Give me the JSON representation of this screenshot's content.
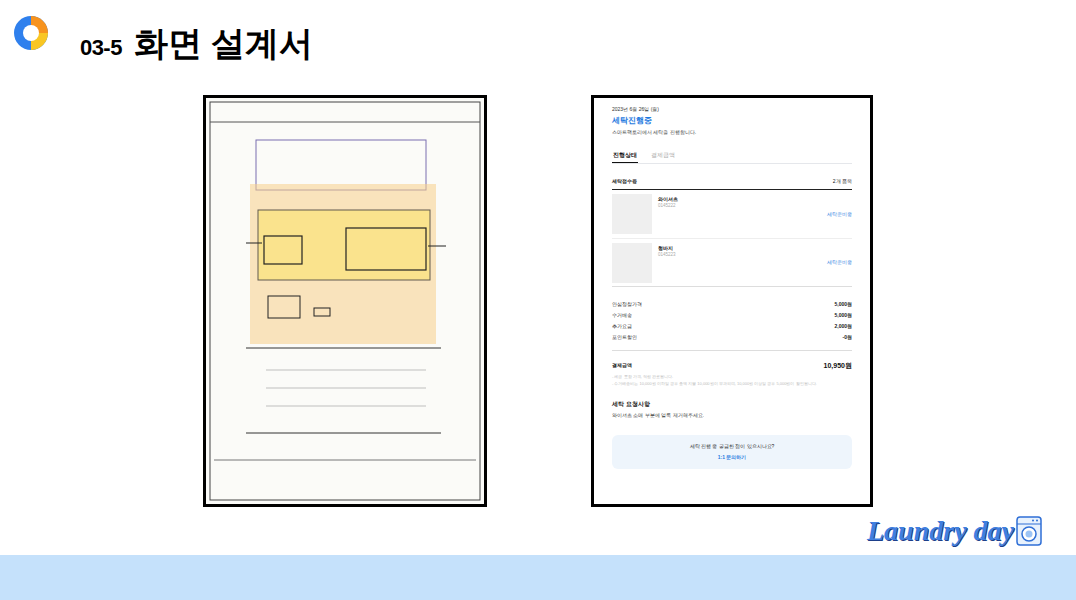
{
  "slide": {
    "section_number": "03-5",
    "title": "화면 설계서"
  },
  "mockup": {
    "date": "2023년 6월 26일 (월)",
    "status_title": "세탁진행중",
    "status_subtitle": "스마트팩토리에서 세탁을 진행합니다.",
    "tabs": [
      {
        "label": "진행상태",
        "selected": true
      },
      {
        "label": "결제금액",
        "selected": false
      }
    ],
    "receipt": {
      "label": "세탁접수증",
      "count": "2개 품목"
    },
    "items": [
      {
        "name": "와이셔츠",
        "code": "0145222",
        "status": "세탁준비중"
      },
      {
        "name": "청바지",
        "code": "0145223",
        "status": "세탁준비중"
      }
    ],
    "prices": [
      {
        "label": "안심정찰가격",
        "value": "5,000원"
      },
      {
        "label": "수거배송",
        "value": "5,000원"
      },
      {
        "label": "추가요금",
        "value": "2,000원"
      },
      {
        "label": "포인트할인",
        "value": "-0원"
      }
    ],
    "total": {
      "label": "결제금액",
      "value": "10,950원"
    },
    "notes": [
      "- 세금 포함 가격, 적립 완료됩니다.",
      "- 수거배송비는 10,000원 이하일 경우 총액 지불 10,000원이 부과되며, 10,000원 이상일 경우 5,000원이 할인됩니다."
    ],
    "request": {
      "title": "세탁 요청사항",
      "text": "와이셔츠 소매 부분에 얼룩 제거해주세요."
    },
    "help": {
      "question": "세탁 진행 중 궁금한 점이 있으시나요?",
      "link": "1:1 문의하기"
    }
  },
  "brand": {
    "name": "Laundry day"
  }
}
